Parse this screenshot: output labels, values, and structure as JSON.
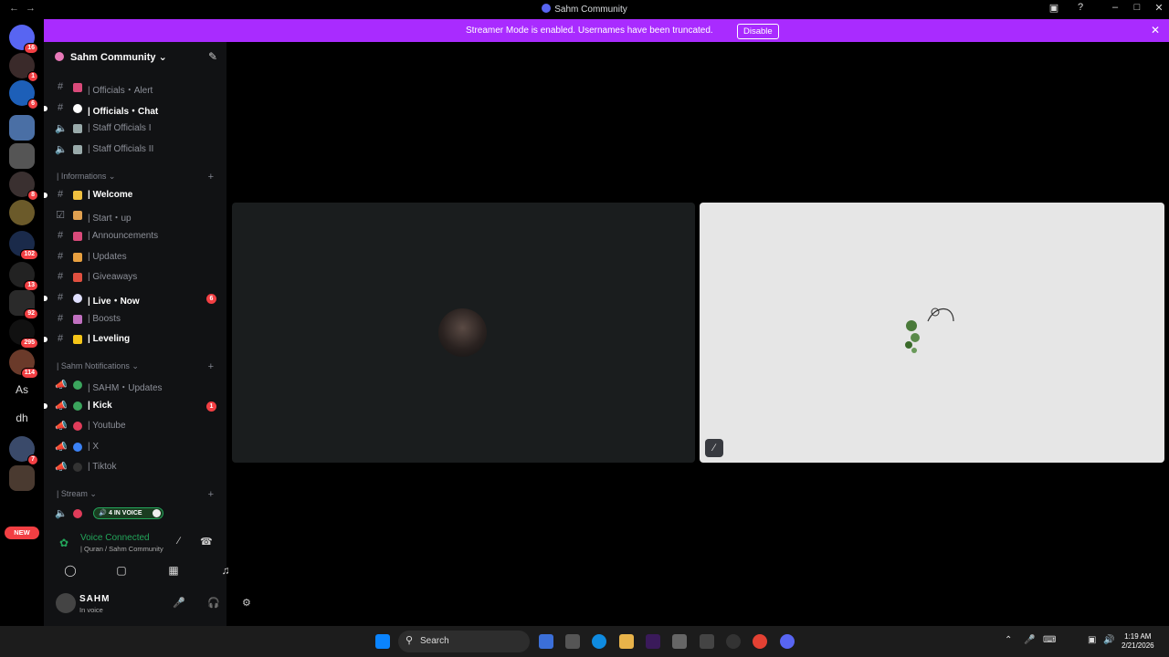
{
  "window": {
    "title": "Sahm Community"
  },
  "banner": {
    "message": "Streamer Mode is enabled. Usernames have been truncated.",
    "disable_label": "Disable",
    "color": "#a92bff"
  },
  "guilds": {
    "badges": [
      "16",
      "1",
      "6",
      "8",
      "102",
      "13",
      "92",
      "295",
      "114",
      "7"
    ],
    "text_avatars": [
      "As",
      "dh"
    ],
    "new_label": "NEW"
  },
  "server": {
    "name": "Sahm Community"
  },
  "channels": [
    {
      "label": "| Officials・Alert"
    },
    {
      "label": "| Officials・Chat"
    },
    {
      "label": "| Staff Officials I"
    },
    {
      "label": "| Staff Officials II"
    },
    {
      "label": "| Welcome"
    },
    {
      "label": "| Start・up"
    },
    {
      "label": "| Announcements"
    },
    {
      "label": "| Updates"
    },
    {
      "label": "| Giveaways"
    },
    {
      "label": "| Live・Now",
      "badge": "6"
    },
    {
      "label": "| Boosts"
    },
    {
      "label": "| Leveling"
    },
    {
      "label": "| SAHM・Updates"
    },
    {
      "label": "| Kick",
      "badge": "1"
    },
    {
      "label": "| Youtube"
    },
    {
      "label": "| X"
    },
    {
      "label": "| Tiktok"
    }
  ],
  "categories": [
    {
      "label": "| Informations"
    },
    {
      "label": "| Sahm Notifications"
    },
    {
      "label": "| Stream"
    }
  ],
  "in_voice": {
    "label": "4 IN VOICE"
  },
  "voice": {
    "status": "Voice Connected",
    "channel": "| Quran / Sahm Community"
  },
  "user": {
    "name": "SAHM",
    "status": "In voice"
  },
  "taskbar": {
    "search_label": "Search",
    "time": "1:19 AM",
    "date": "2/21/2026"
  }
}
